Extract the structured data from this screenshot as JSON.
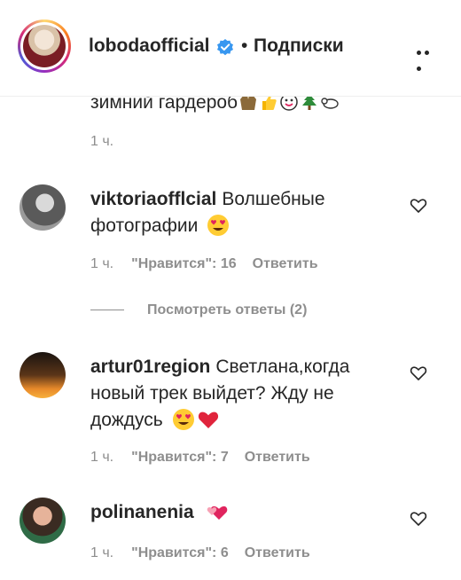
{
  "header": {
    "username": "lobodaofficial",
    "dot": "•",
    "follow_label": "Подписки",
    "verified_icon": "verified-badge-icon",
    "more_icon": "more-options-icon",
    "accent": "#3897f0"
  },
  "partial_comment": {
    "text": "зимний гардероб",
    "time": "1 ч."
  },
  "comments": [
    {
      "username": "viktoriaofflcial",
      "text": "Волшебные фотографии",
      "time": "1 ч.",
      "likes": "\"Нравится\": 16",
      "reply": "Ответить",
      "view_replies": "Посмотреть ответы (2)"
    },
    {
      "username": "artur01region",
      "text": "Светлана,когда новый трек выйдет? Жду не дождусь",
      "time": "1 ч.",
      "likes": "\"Нравится\": 7",
      "reply": "Ответить"
    },
    {
      "username": "polinanenia",
      "text": "",
      "time": "1 ч.",
      "likes": "\"Нравится\": 6",
      "reply": "Ответить"
    }
  ]
}
